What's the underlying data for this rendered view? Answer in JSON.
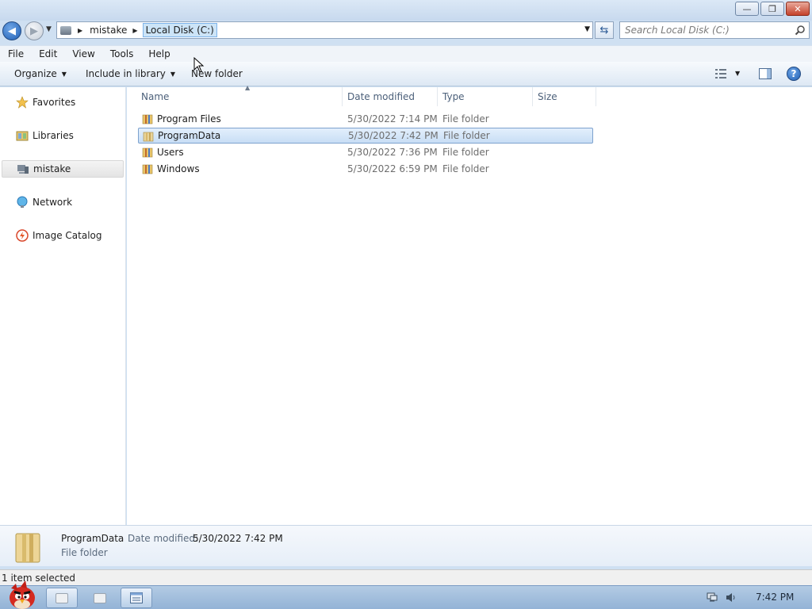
{
  "window": {
    "controls": {
      "minimize": "—",
      "maximize": "❐",
      "close": "✕"
    }
  },
  "address": {
    "breadcrumbs": [
      "mistake",
      "Local Disk (C:)"
    ],
    "search_placeholder": "Search Local Disk (C:)"
  },
  "menu": [
    "File",
    "Edit",
    "View",
    "Tools",
    "Help"
  ],
  "toolbar": {
    "organize": "Organize",
    "include_in_library": "Include in library",
    "new_folder": "New folder"
  },
  "nav": [
    "Favorites",
    "Libraries",
    "mistake",
    "Network",
    "Image Catalog"
  ],
  "columns": [
    "Name",
    "Date modified",
    "Type",
    "Size"
  ],
  "files": [
    {
      "name": "Program Files",
      "date": "5/30/2022 7:14 PM",
      "type": "File folder",
      "selected": false
    },
    {
      "name": "ProgramData",
      "date": "5/30/2022 7:42 PM",
      "type": "File folder",
      "selected": true
    },
    {
      "name": "Users",
      "date": "5/30/2022 7:36 PM",
      "type": "File folder",
      "selected": false
    },
    {
      "name": "Windows",
      "date": "5/30/2022 6:59 PM",
      "type": "File folder",
      "selected": false
    }
  ],
  "details": {
    "name": "ProgramData",
    "date_label": "Date modified:",
    "date_value": "5/30/2022 7:42 PM",
    "type": "File folder"
  },
  "status": {
    "text": "1 item selected"
  },
  "taskbar": {
    "clock": "7:42 PM"
  },
  "colors": {
    "accent": "#1f5fb5",
    "selection": "#c8def5",
    "taskbar": "#93b3d6"
  },
  "icons": [
    "back-arrow-icon",
    "forward-arrow-icon",
    "refresh-icon",
    "search-icon",
    "view-options-icon",
    "preview-pane-icon",
    "help-icon",
    "folder-icon",
    "favorites-star-icon",
    "libraries-icon",
    "computer-icon",
    "network-icon",
    "image-catalog-icon",
    "start-orb-icon",
    "network-tray-icon",
    "volume-tray-icon"
  ]
}
